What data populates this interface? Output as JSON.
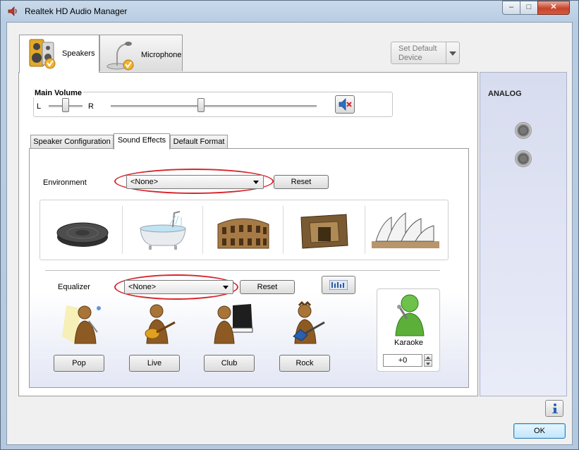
{
  "window": {
    "title": "Realtek HD Audio Manager",
    "caption": {
      "minimize": "‒",
      "maximize": "□",
      "close": "✕"
    }
  },
  "device_tabs": [
    {
      "label": "Speakers",
      "active": true,
      "icon": "speaker-icon"
    },
    {
      "label": "Microphone",
      "active": false,
      "icon": "microphone-icon"
    }
  ],
  "volume": {
    "title": "Main Volume",
    "balance_left": "L",
    "balance_right": "R",
    "balance_level": 0.5,
    "level": 0.44,
    "mute_icon": "speaker-muted-icon"
  },
  "set_default": {
    "label": "Set Default Device"
  },
  "sub_tabs": [
    {
      "label": "Speaker Configuration",
      "active": false
    },
    {
      "label": "Sound Effects",
      "active": true
    },
    {
      "label": "Default Format",
      "active": false
    }
  ],
  "environment": {
    "label": "Environment",
    "value": "<None>",
    "reset_label": "Reset",
    "presets": [
      "disc-icon",
      "bathtub-icon",
      "colosseum-icon",
      "stone-room-icon",
      "opera-house-icon"
    ]
  },
  "equalizer": {
    "label": "Equalizer",
    "value": "<None>",
    "reset_label": "Reset",
    "presets": [
      {
        "label": "Pop",
        "icon": "pop-singer-icon"
      },
      {
        "label": "Live",
        "icon": "live-guitarist-icon"
      },
      {
        "label": "Club",
        "icon": "club-pianist-icon"
      },
      {
        "label": "Rock",
        "icon": "rock-guitarist-icon"
      }
    ]
  },
  "karaoke": {
    "label": "Karaoke",
    "value": "+0"
  },
  "analog": {
    "label": "ANALOG"
  },
  "footer": {
    "ok_label": "OK",
    "info_icon": "info-icon"
  },
  "colors": {
    "highlight_ellipse": "#d8252b",
    "ok_border": "#3c7fb1"
  }
}
